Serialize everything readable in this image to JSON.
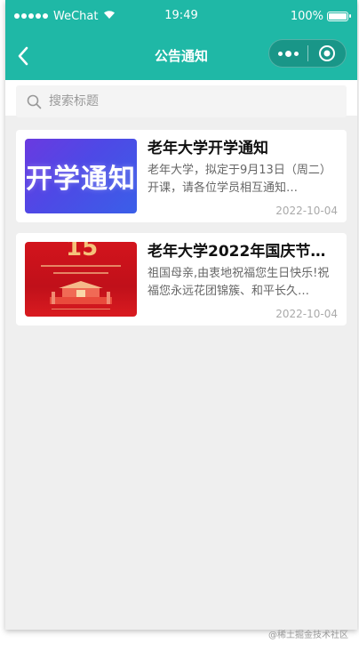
{
  "status": {
    "carrier": "WeChat",
    "time": "19:49",
    "battery": "100%"
  },
  "nav": {
    "title": "公告通知"
  },
  "search": {
    "placeholder": "搜索标题"
  },
  "notices": [
    {
      "thumb_text": "开学通知",
      "title": "老年大学开学通知",
      "desc": "老年大学，拟定于9月13日（周二）开课，请各位学员相互通知…",
      "date": "2022-10-04"
    },
    {
      "thumb_text": "15",
      "title": "老年大学2022年国庆节…",
      "desc": "祖国母亲,由衷地祝福您生日快乐!祝福您永远花团锦簇、和平长久…",
      "date": "2022-10-04"
    }
  ],
  "watermark": "@稀土掘金技术社区",
  "colors": {
    "primary": "#1fb8a6",
    "background": "#efefef"
  }
}
